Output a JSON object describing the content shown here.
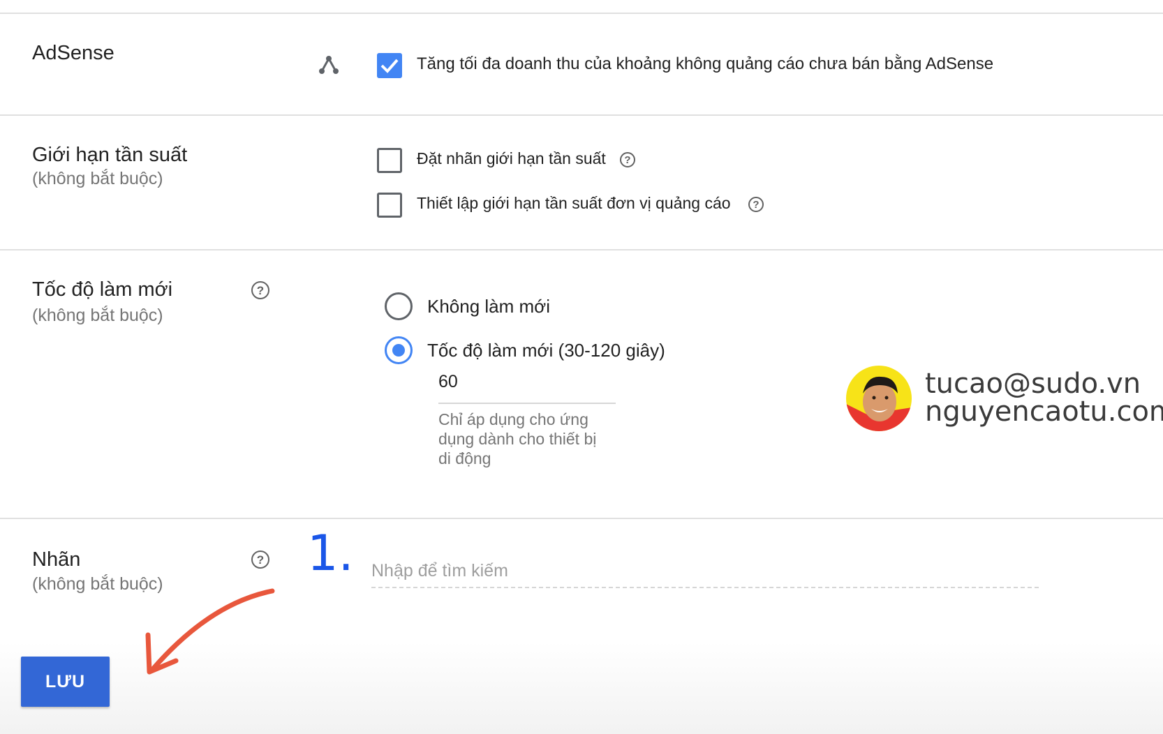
{
  "adsense": {
    "title": "AdSense",
    "checkbox_label": "Tăng tối đa doanh thu của khoảng không quảng cáo chưa bán bằng AdSense",
    "checked": true
  },
  "frequency": {
    "title": "Giới hạn tần suất",
    "subtitle": "(không bắt buộc)",
    "options": [
      {
        "label": "Đặt nhãn giới hạn tần suất",
        "checked": false
      },
      {
        "label": "Thiết lập giới hạn tần suất đơn vị quảng cáo",
        "checked": false
      }
    ]
  },
  "refresh": {
    "title": "Tốc độ làm mới",
    "subtitle": "(không bắt buộc)",
    "options": [
      {
        "label": "Không làm mới",
        "selected": false
      },
      {
        "label": "Tốc độ làm mới (30-120 giây)",
        "selected": true
      }
    ],
    "input_value": "60",
    "hint_lines": [
      "Chỉ áp dụng cho ứng",
      "dụng dành cho thiết bị",
      "di động"
    ]
  },
  "labels": {
    "title": "Nhãn",
    "subtitle": "(không bắt buộc)",
    "step_number": "1.",
    "search_placeholder": "Nhập để tìm kiếm"
  },
  "watermark": {
    "line1": "tucao@sudo.vn",
    "line2": "nguyencaotu.com"
  },
  "save_label": "LƯU",
  "colors": {
    "accent": "#4285f4",
    "button": "#3367d6",
    "annotation_arrow": "#e8573c",
    "step_number": "#1a56e8"
  },
  "icons": [
    "help-circle-icon",
    "checkmark-icon",
    "share-nodes-icon",
    "annotation-arrow",
    "avatar-photo"
  ]
}
